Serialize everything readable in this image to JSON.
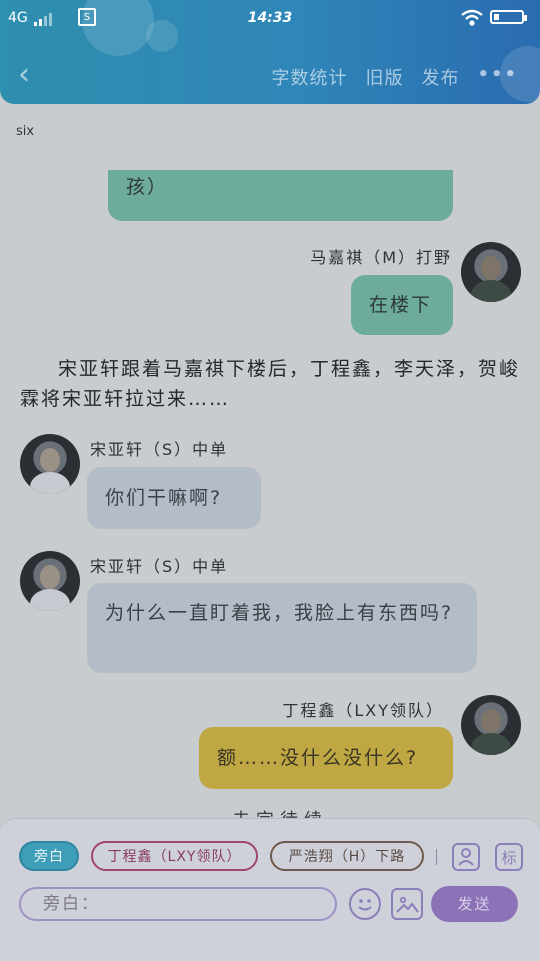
{
  "status_bar": {
    "network": "4G",
    "time": "14:33"
  },
  "nav": {
    "back_icon": "‹",
    "word_count": "字数统计",
    "old_version": "旧版",
    "publish": "发布",
    "more": "•••"
  },
  "story": {
    "author": "six",
    "messages": [
      {
        "speaker": "",
        "text": "孩）",
        "side": "right",
        "color": "teal"
      },
      {
        "speaker": "马嘉祺（M）打野",
        "text": "在楼下",
        "side": "right",
        "color": "teal"
      },
      {
        "speaker": "宋亚轩（S）中单",
        "text": "你们干嘛啊?",
        "side": "left",
        "color": "grey"
      },
      {
        "speaker": "宋亚轩（S）中单",
        "text": "为什么一直盯着我，我脸上有东西吗?",
        "side": "left",
        "color": "grey"
      },
      {
        "speaker": "丁程鑫（LXY领队）",
        "text": "额……没什么没什么?",
        "side": "right",
        "color": "yellow"
      }
    ],
    "narration": "宋亚轩跟着马嘉祺下楼后，丁程鑫，李天泽，贺峻霖将宋亚轩拉过来……",
    "trailing_text": "未完待续"
  },
  "panel": {
    "chips": [
      "旁白",
      "丁程鑫（LXY领队）",
      "严浩翔（H）下路"
    ],
    "role_icon": "person-icon",
    "tag_icon_label": "标",
    "input_placeholder": "旁白：",
    "emoji_icon": "emoji-icon",
    "image_icon": "image-icon",
    "send_label": "发送"
  }
}
